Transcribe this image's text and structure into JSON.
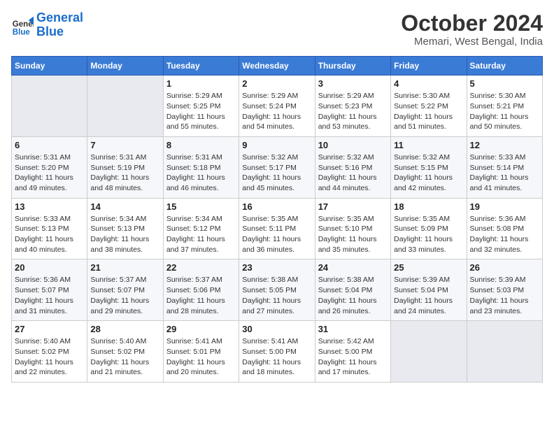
{
  "logo": {
    "line1": "General",
    "line2": "Blue"
  },
  "title": "October 2024",
  "location": "Memari, West Bengal, India",
  "days_header": [
    "Sunday",
    "Monday",
    "Tuesday",
    "Wednesday",
    "Thursday",
    "Friday",
    "Saturday"
  ],
  "weeks": [
    [
      {
        "day": "",
        "info": ""
      },
      {
        "day": "",
        "info": ""
      },
      {
        "day": "1",
        "info": "Sunrise: 5:29 AM\nSunset: 5:25 PM\nDaylight: 11 hours and 55 minutes."
      },
      {
        "day": "2",
        "info": "Sunrise: 5:29 AM\nSunset: 5:24 PM\nDaylight: 11 hours and 54 minutes."
      },
      {
        "day": "3",
        "info": "Sunrise: 5:29 AM\nSunset: 5:23 PM\nDaylight: 11 hours and 53 minutes."
      },
      {
        "day": "4",
        "info": "Sunrise: 5:30 AM\nSunset: 5:22 PM\nDaylight: 11 hours and 51 minutes."
      },
      {
        "day": "5",
        "info": "Sunrise: 5:30 AM\nSunset: 5:21 PM\nDaylight: 11 hours and 50 minutes."
      }
    ],
    [
      {
        "day": "6",
        "info": "Sunrise: 5:31 AM\nSunset: 5:20 PM\nDaylight: 11 hours and 49 minutes."
      },
      {
        "day": "7",
        "info": "Sunrise: 5:31 AM\nSunset: 5:19 PM\nDaylight: 11 hours and 48 minutes."
      },
      {
        "day": "8",
        "info": "Sunrise: 5:31 AM\nSunset: 5:18 PM\nDaylight: 11 hours and 46 minutes."
      },
      {
        "day": "9",
        "info": "Sunrise: 5:32 AM\nSunset: 5:17 PM\nDaylight: 11 hours and 45 minutes."
      },
      {
        "day": "10",
        "info": "Sunrise: 5:32 AM\nSunset: 5:16 PM\nDaylight: 11 hours and 44 minutes."
      },
      {
        "day": "11",
        "info": "Sunrise: 5:32 AM\nSunset: 5:15 PM\nDaylight: 11 hours and 42 minutes."
      },
      {
        "day": "12",
        "info": "Sunrise: 5:33 AM\nSunset: 5:14 PM\nDaylight: 11 hours and 41 minutes."
      }
    ],
    [
      {
        "day": "13",
        "info": "Sunrise: 5:33 AM\nSunset: 5:13 PM\nDaylight: 11 hours and 40 minutes."
      },
      {
        "day": "14",
        "info": "Sunrise: 5:34 AM\nSunset: 5:13 PM\nDaylight: 11 hours and 38 minutes."
      },
      {
        "day": "15",
        "info": "Sunrise: 5:34 AM\nSunset: 5:12 PM\nDaylight: 11 hours and 37 minutes."
      },
      {
        "day": "16",
        "info": "Sunrise: 5:35 AM\nSunset: 5:11 PM\nDaylight: 11 hours and 36 minutes."
      },
      {
        "day": "17",
        "info": "Sunrise: 5:35 AM\nSunset: 5:10 PM\nDaylight: 11 hours and 35 minutes."
      },
      {
        "day": "18",
        "info": "Sunrise: 5:35 AM\nSunset: 5:09 PM\nDaylight: 11 hours and 33 minutes."
      },
      {
        "day": "19",
        "info": "Sunrise: 5:36 AM\nSunset: 5:08 PM\nDaylight: 11 hours and 32 minutes."
      }
    ],
    [
      {
        "day": "20",
        "info": "Sunrise: 5:36 AM\nSunset: 5:07 PM\nDaylight: 11 hours and 31 minutes."
      },
      {
        "day": "21",
        "info": "Sunrise: 5:37 AM\nSunset: 5:07 PM\nDaylight: 11 hours and 29 minutes."
      },
      {
        "day": "22",
        "info": "Sunrise: 5:37 AM\nSunset: 5:06 PM\nDaylight: 11 hours and 28 minutes."
      },
      {
        "day": "23",
        "info": "Sunrise: 5:38 AM\nSunset: 5:05 PM\nDaylight: 11 hours and 27 minutes."
      },
      {
        "day": "24",
        "info": "Sunrise: 5:38 AM\nSunset: 5:04 PM\nDaylight: 11 hours and 26 minutes."
      },
      {
        "day": "25",
        "info": "Sunrise: 5:39 AM\nSunset: 5:04 PM\nDaylight: 11 hours and 24 minutes."
      },
      {
        "day": "26",
        "info": "Sunrise: 5:39 AM\nSunset: 5:03 PM\nDaylight: 11 hours and 23 minutes."
      }
    ],
    [
      {
        "day": "27",
        "info": "Sunrise: 5:40 AM\nSunset: 5:02 PM\nDaylight: 11 hours and 22 minutes."
      },
      {
        "day": "28",
        "info": "Sunrise: 5:40 AM\nSunset: 5:02 PM\nDaylight: 11 hours and 21 minutes."
      },
      {
        "day": "29",
        "info": "Sunrise: 5:41 AM\nSunset: 5:01 PM\nDaylight: 11 hours and 20 minutes."
      },
      {
        "day": "30",
        "info": "Sunrise: 5:41 AM\nSunset: 5:00 PM\nDaylight: 11 hours and 18 minutes."
      },
      {
        "day": "31",
        "info": "Sunrise: 5:42 AM\nSunset: 5:00 PM\nDaylight: 11 hours and 17 minutes."
      },
      {
        "day": "",
        "info": ""
      },
      {
        "day": "",
        "info": ""
      }
    ]
  ]
}
